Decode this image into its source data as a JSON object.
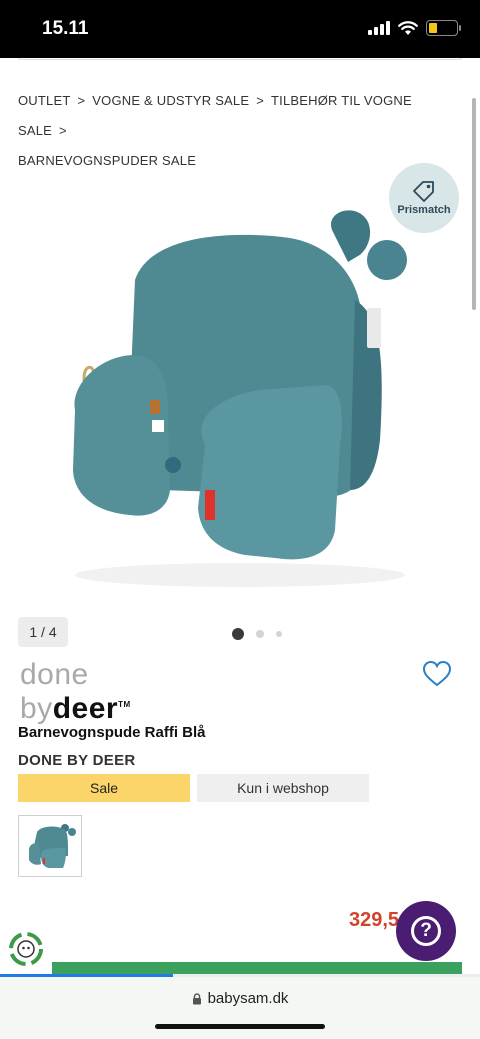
{
  "status_bar": {
    "time": "15.11",
    "battery_color": "#f5c518"
  },
  "breadcrumb": {
    "items": [
      "OUTLET",
      "VOGNE & UDSTYR SALE",
      "TILBEHØR TIL VOGNE SALE",
      "BARNEVOGNSPUDER SALE"
    ],
    "separator": ">"
  },
  "gallery": {
    "counter": "1 / 4",
    "current_index": 1,
    "total": 4,
    "dots": 3
  },
  "prismatch": {
    "label": "Prismatch",
    "icon": "tag-icon"
  },
  "brand_logo": {
    "line1": "done",
    "by": "by",
    "deer": "deer",
    "tm": "TM"
  },
  "product": {
    "title": "Barnevognspude Raffi Blå",
    "brand": "DONE BY DEER",
    "price": "329,5",
    "price_color": "#d1442c",
    "product_color": "#4f8a93"
  },
  "tags": {
    "sale": "Sale",
    "webshop": "Kun i webshop",
    "sale_color": "#fbd46a"
  },
  "help_button": {
    "label": "?",
    "color": "#4b1d72"
  },
  "page_load_progress": 0.36,
  "url_bar": {
    "domain": "babysam.dk"
  }
}
